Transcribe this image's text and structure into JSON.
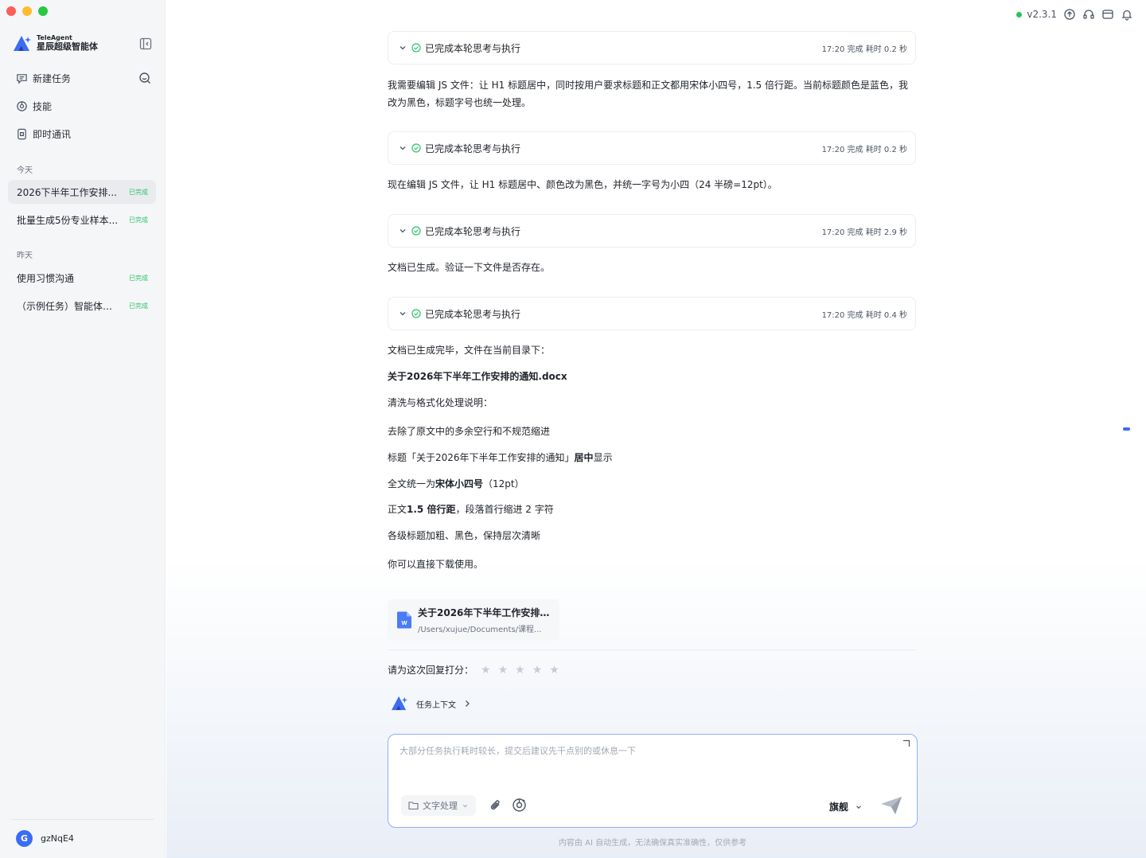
{
  "app": {
    "brand_small": "TeleAgent",
    "brand_name": "星辰超级智能体",
    "version": "v2.3.1",
    "accent": "#3b6cf6",
    "online_color": "#22c55e"
  },
  "sidebar": {
    "nav": [
      {
        "label": "新建任务",
        "icon": "new-task-icon"
      },
      {
        "label": "技能",
        "icon": "skill-icon"
      },
      {
        "label": "即时通讯",
        "icon": "message-icon"
      }
    ],
    "groups": [
      {
        "label": "今天",
        "tasks": [
          {
            "title": "2026下半年工作安排...",
            "status": "已完成",
            "active": true
          },
          {
            "title": "批量生成5份专业样本...",
            "status": "已完成",
            "active": false
          }
        ]
      },
      {
        "label": "昨天",
        "tasks": [
          {
            "title": "使用习惯沟通",
            "status": "已完成",
            "active": false
          },
          {
            "title": "（示例任务）智能体招...",
            "status": "已完成",
            "active": false
          }
        ]
      }
    ],
    "user": {
      "initial": "G",
      "name": "gzNqE4"
    }
  },
  "chat": {
    "steps": [
      {
        "label": "已完成本轮思考与执行",
        "time": "17:20 完成 耗时 0.2 秒"
      },
      {
        "label": "已完成本轮思考与执行",
        "time": "17:20 完成 耗时 0.2 秒"
      },
      {
        "label": "已完成本轮思考与执行",
        "time": "17:20 完成 耗时 2.9 秒"
      },
      {
        "label": "已完成本轮思考与执行",
        "time": "17:20 完成 耗时 0.4 秒"
      }
    ],
    "messages": {
      "m1": "我需要编辑 JS 文件：让 H1 标题居中，同时按用户要求标题和正文都用宋体小四号，1.5 倍行距。当前标题颜色是蓝色，我改为黑色，标题字号也统一处理。",
      "m2": "现在编辑 JS 文件，让 H1 标题居中、颜色改为黑色，并统一字号为小四（24 半磅=12pt）。",
      "m3": "文档已生成。验证一下文件是否存在。",
      "m4": "文档已生成完毕，文件在当前目录下：",
      "file_bold": "关于2026年下半年工作安排的通知.docx",
      "notes_title": "清洗与格式化处理说明：",
      "note1": "去除了原文中的多余空行和不规范缩进",
      "note2_a": "标题「关于2026年下半年工作安排的通知」",
      "note2_b": "居中",
      "note2_c": "显示",
      "note3_a": "全文统一为",
      "note3_b": "宋体小四号",
      "note3_c": "（12pt）",
      "note4_a": "正文",
      "note4_b": "1.5 倍行距",
      "note4_c": "，段落首行缩进 2 字符",
      "note5": "各级标题加粗、黑色，保持层次清晰",
      "closing": "你可以直接下载使用。"
    },
    "file_card": {
      "name": "关于2026年下半年工作安排...",
      "path": "/Users/xujue/Documents/课程..."
    },
    "rating_label": "请为这次回复打分：",
    "rating_value": 0,
    "rating_max": 5,
    "context_label": "任务上下文"
  },
  "composer": {
    "placeholder": "大部分任务执行耗时较长，提交后建议先干点别的或休息一下",
    "category": "文字处理",
    "model": "旗舰"
  },
  "disclaimer": "内容由 AI 自动生成，无法确保真实准确性，仅供参考"
}
